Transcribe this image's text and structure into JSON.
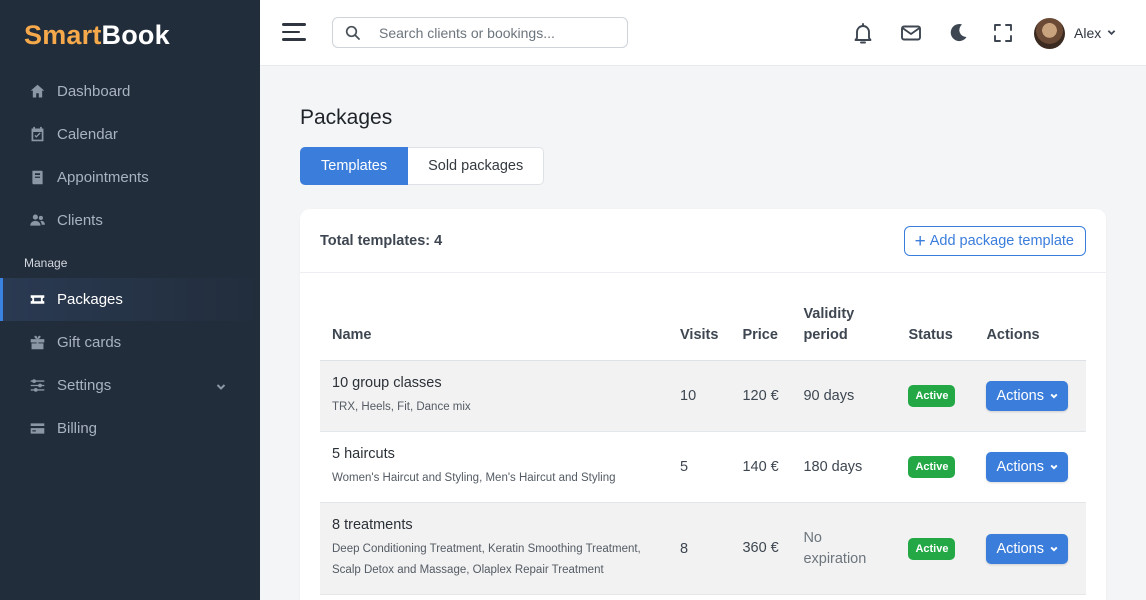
{
  "brand": {
    "part1": "Smart",
    "part2": "Book"
  },
  "sidebar": {
    "items": [
      {
        "label": "Dashboard",
        "icon": "home-icon"
      },
      {
        "label": "Calendar",
        "icon": "calendar-check-icon"
      },
      {
        "label": "Appointments",
        "icon": "book-icon"
      },
      {
        "label": "Clients",
        "icon": "users-icon"
      }
    ],
    "section_label": "Manage",
    "manage_items": [
      {
        "label": "Packages",
        "icon": "ticket-icon",
        "active": true
      },
      {
        "label": "Gift cards",
        "icon": "gift-icon"
      },
      {
        "label": "Settings",
        "icon": "sliders-icon",
        "has_submenu": true
      },
      {
        "label": "Billing",
        "icon": "credit-card-icon"
      }
    ]
  },
  "header": {
    "search_placeholder": "Search clients or bookings...",
    "user_name": "Alex",
    "icons": [
      "menu-icon",
      "search-icon",
      "bell-icon",
      "envelope-icon",
      "moon-icon",
      "fullscreen-icon",
      "avatar",
      "chevron-down-icon"
    ]
  },
  "page": {
    "title": "Packages",
    "tabs": [
      {
        "label": "Templates",
        "active": true
      },
      {
        "label": "Sold packages",
        "active": false
      }
    ],
    "total_label": "Total templates: 4",
    "add_button": "Add package template"
  },
  "table": {
    "columns": [
      "Name",
      "Visits",
      "Price",
      "Validity period",
      "Status",
      "Actions"
    ],
    "rows": [
      {
        "name": "10 group classes",
        "services": "TRX, Heels, Fit, Dance mix",
        "visits": "10",
        "price": "120 €",
        "validity": "90 days",
        "status": "Active",
        "action": "Actions"
      },
      {
        "name": "5 haircuts",
        "services": "Women's Haircut and Styling, Men's Haircut and Styling",
        "visits": "5",
        "price": "140 €",
        "validity": "180 days",
        "status": "Active",
        "action": "Actions"
      },
      {
        "name": "8 treatments",
        "services": "Deep Conditioning Treatment, Keratin Smoothing Treatment, Scalp Detox and Massage, Olaplex Repair Treatment",
        "visits": "8",
        "price": "360 €",
        "validity": "No expiration",
        "status": "Active",
        "action": "Actions"
      }
    ]
  },
  "colors": {
    "sidebar_bg": "#222d3c",
    "accent": "#3a7ddb",
    "brand_orange": "#f5a94a",
    "status_active": "#23a845"
  }
}
